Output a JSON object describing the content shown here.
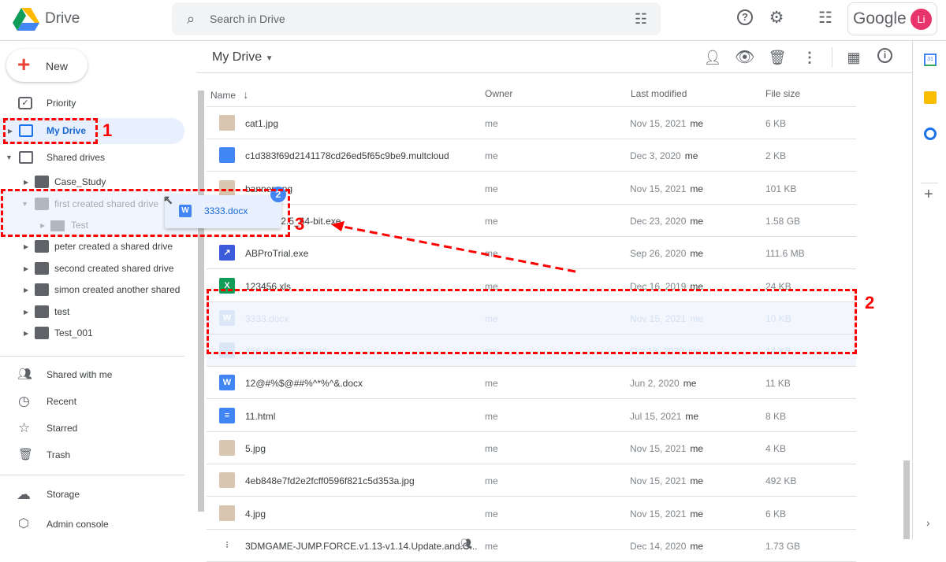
{
  "app": {
    "name": "Drive",
    "account_brand": "Google",
    "avatar_initials": "Li"
  },
  "search": {
    "placeholder": "Search in Drive"
  },
  "sidebar": {
    "new_label": "New",
    "priority": "Priority",
    "my_drive": "My Drive",
    "shared_drives": "Shared drives",
    "drives": [
      "Case_Study",
      "first created shared drive",
      "peter created a shared drive",
      "second created shared drive",
      "simon created another shared ...",
      "test",
      "Test_001"
    ],
    "subfolder": "Test",
    "shared_with_me": "Shared with me",
    "recent": "Recent",
    "starred": "Starred",
    "trash": "Trash",
    "storage": "Storage",
    "admin_console": "Admin console"
  },
  "main": {
    "title": "My Drive",
    "columns": {
      "name": "Name",
      "owner": "Owner",
      "modified": "Last modified",
      "size": "File size"
    },
    "files": [
      {
        "name": "cat1.jpg",
        "owner": "me",
        "date": "Nov 15, 2021",
        "by": "me",
        "size": "6 KB",
        "type": "image"
      },
      {
        "name": "c1d383f69d2141178cd26ed5f65c9be9.multcloud",
        "owner": "me",
        "date": "Dec 3, 2020",
        "by": "me",
        "size": "2 KB",
        "type": "file"
      },
      {
        "name": "banner.png",
        "owner": "me",
        "date": "Nov 15, 2021",
        "by": "me",
        "size": "101 KB",
        "type": "image"
      },
      {
        "name": "ackup_12.5_64-bit.exe",
        "owner": "me",
        "date": "Dec 23, 2020",
        "by": "me",
        "size": "1.58 GB",
        "type": "exe"
      },
      {
        "name": "ABProTrial.exe",
        "owner": "me",
        "date": "Sep 26, 2020",
        "by": "me",
        "size": "111.6 MB",
        "type": "exe"
      },
      {
        "name": "123456.xls",
        "owner": "me",
        "date": "Dec 16, 2019",
        "by": "me",
        "size": "24 KB",
        "type": "xls"
      },
      {
        "name": "3333.docx",
        "owner": "me",
        "date": "Nov 15, 2021",
        "by": "me",
        "size": "10 KB",
        "type": "word",
        "ghost": true
      },
      {
        "name": "456.docx.multcloud",
        "owner": "me",
        "date": "Oct 13, 2020",
        "by": "me",
        "size": "14 KB",
        "type": "file",
        "ghost": true
      },
      {
        "name": "12@#%$@##%^*%^&.docx",
        "owner": "me",
        "date": "Jun 2, 2020",
        "by": "me",
        "size": "11 KB",
        "type": "word"
      },
      {
        "name": "11.html",
        "owner": "me",
        "date": "Jul 15, 2021",
        "by": "me",
        "size": "8 KB",
        "type": "doc"
      },
      {
        "name": "5.jpg",
        "owner": "me",
        "date": "Nov 15, 2021",
        "by": "me",
        "size": "4 KB",
        "type": "image"
      },
      {
        "name": "4eb848e7fd2e2fcff0596f821c5d353a.jpg",
        "owner": "me",
        "date": "Nov 15, 2021",
        "by": "me",
        "size": "492 KB",
        "type": "image"
      },
      {
        "name": "4.jpg",
        "owner": "me",
        "date": "Nov 15, 2021",
        "by": "me",
        "size": "6 KB",
        "type": "image"
      },
      {
        "name": "3DMGAME-JUMP.FORCE.v1.13-v1.14.Update.and.C...",
        "owner": "me",
        "date": "Dec 14, 2020",
        "by": "me",
        "size": "1.73 GB",
        "type": "archive",
        "shared": true
      }
    ]
  },
  "drag": {
    "file": "3333.docx",
    "count": "2"
  },
  "annotations": {
    "one": "1",
    "two": "2",
    "three": "3"
  },
  "colors": {
    "accent": "#1a73e8",
    "annotation": "#ff0000",
    "avatar": "#e8336d"
  }
}
